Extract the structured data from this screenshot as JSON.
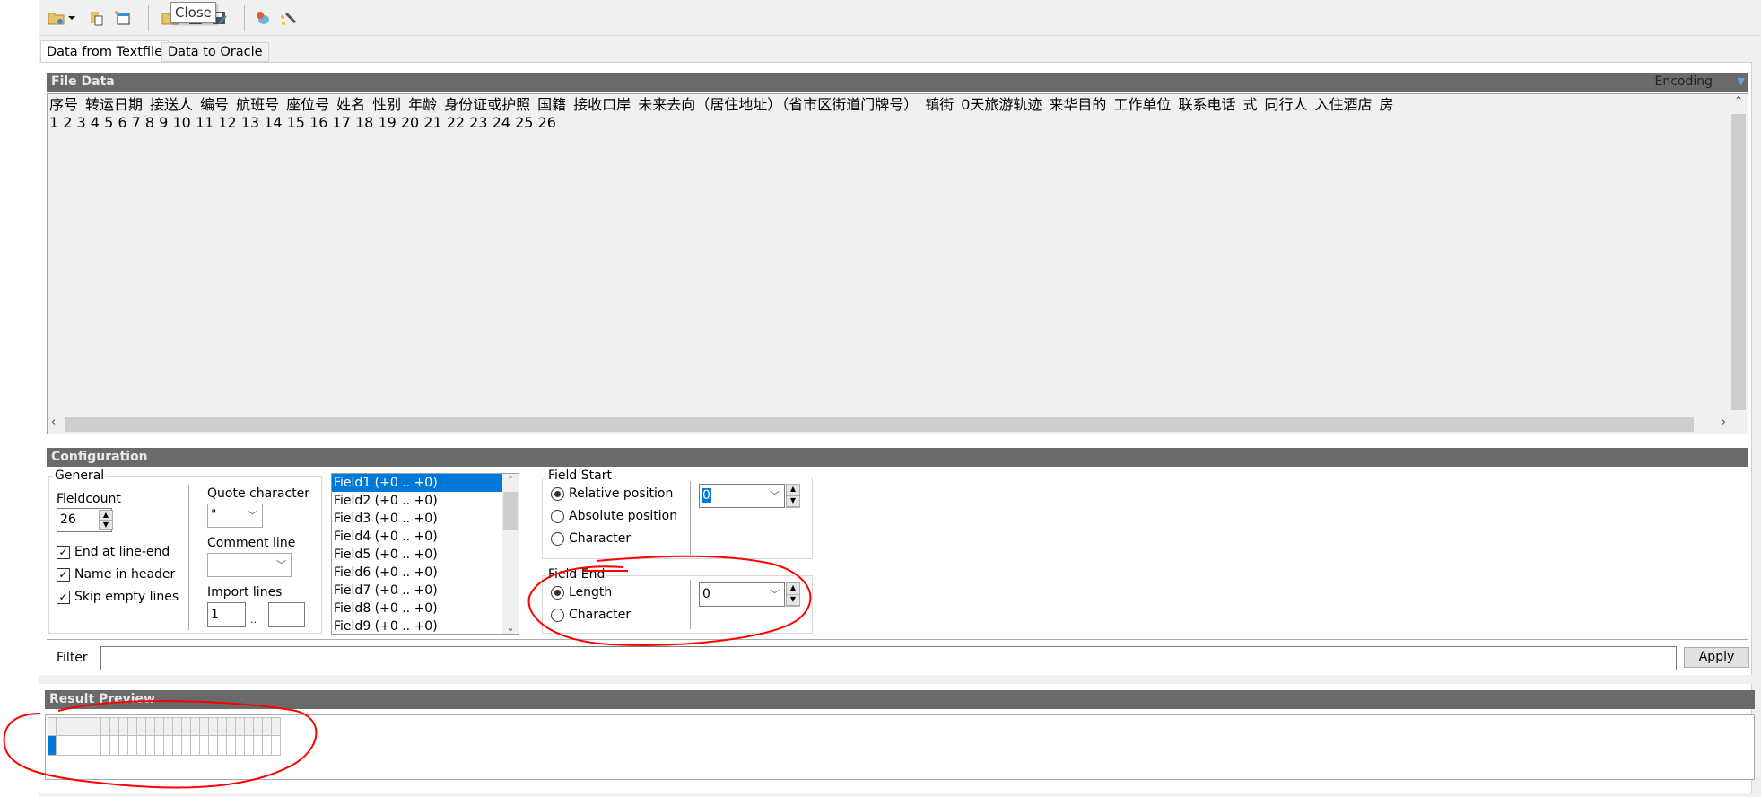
{
  "toolbar": {
    "tooltip": "Close",
    "icons": [
      "open-folder-icon",
      "dropdown-arrow-icon",
      "paste-icon",
      "new-window-icon",
      "open-icon",
      "save-icon",
      "save-as-icon",
      "database-icon",
      "wand-icon"
    ]
  },
  "tabs": [
    {
      "label": "Data from Textfile",
      "active": true
    },
    {
      "label": "Data to Oracle",
      "active": false
    }
  ],
  "file_data": {
    "title": "File Data",
    "encoding_label": "Encoding",
    "header_line": [
      "序号",
      "转运日期",
      "接送人",
      "编号",
      "航班号",
      "座位号",
      "姓名",
      "性别",
      "年龄",
      "身份证或护照",
      "国籍",
      "接收口岸",
      "未来去向（居住地址）（省市区街道门牌号）",
      "镇街",
      "0天旅游轨迹",
      "来华目的",
      "工作单位",
      "联系电话",
      "式",
      "同行人",
      "入住酒店",
      "房"
    ],
    "data_line": "1 2 3 4 5 6 7 8 9 10 11 12 13 14 15 16 17 18 19 20 21 22 23 24 25 26"
  },
  "configuration": {
    "title": "Configuration",
    "general": {
      "legend": "General",
      "fieldcount_label": "Fieldcount",
      "fieldcount_value": "26",
      "checkboxes": [
        {
          "label": "End at line-end",
          "checked": true
        },
        {
          "label": "Name in header",
          "checked": true
        },
        {
          "label": "Skip empty lines",
          "checked": true
        }
      ],
      "quote_label": "Quote character",
      "quote_value": "\"",
      "comment_label": "Comment line",
      "comment_value": "",
      "import_label": "Import lines",
      "import_from": "1",
      "import_sep": "..",
      "import_to": ""
    },
    "fields": [
      "Field1  (+0 .. +0)",
      "Field2  (+0 .. +0)",
      "Field3  (+0 .. +0)",
      "Field4  (+0 .. +0)",
      "Field5  (+0 .. +0)",
      "Field6  (+0 .. +0)",
      "Field7  (+0 .. +0)",
      "Field8  (+0 .. +0)",
      "Field9  (+0 .. +0)"
    ],
    "selected_field": 0,
    "field_start": {
      "legend": "Field Start",
      "options": [
        {
          "label": "Relative position",
          "selected": true
        },
        {
          "label": "Absolute position",
          "selected": false
        },
        {
          "label": "Character",
          "selected": false
        }
      ],
      "value": "0"
    },
    "field_end": {
      "legend": "Field End",
      "options": [
        {
          "label": "Length",
          "selected": true
        },
        {
          "label": "Character",
          "selected": false
        }
      ],
      "value": "0"
    }
  },
  "filter": {
    "label": "Filter",
    "value": "",
    "apply_label": "Apply"
  },
  "result_preview": {
    "title": "Result Preview",
    "columns": 26,
    "rows": 1
  },
  "colors": {
    "header_bar": "#6a6a6a",
    "selection": "#0078d7",
    "annotation": "#ff0000"
  }
}
